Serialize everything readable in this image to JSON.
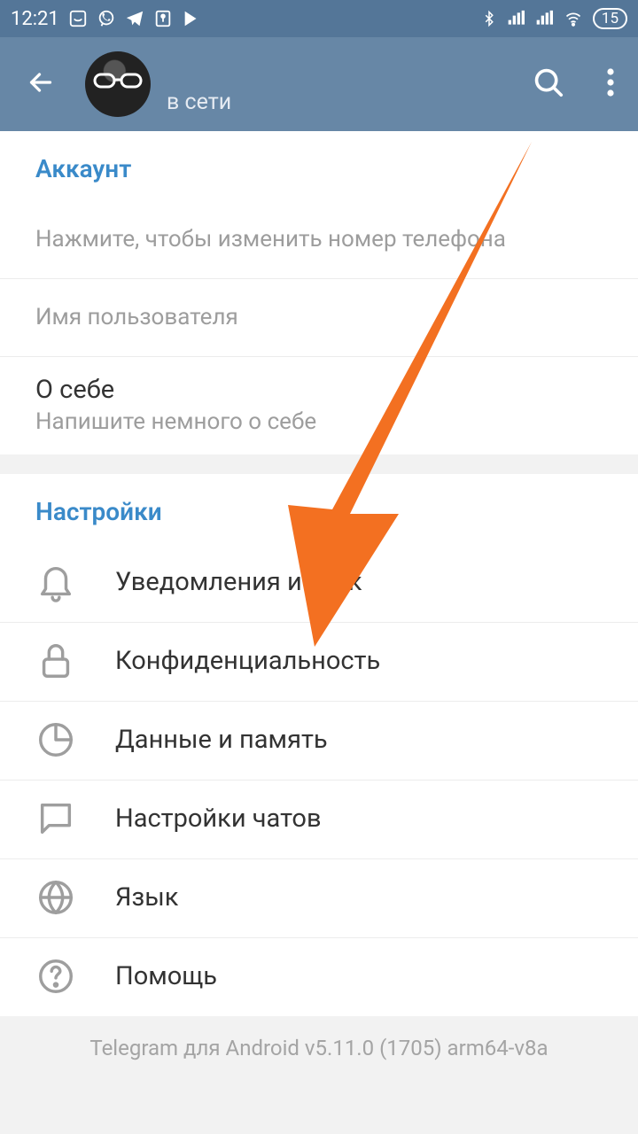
{
  "statusbar": {
    "time": "12:21",
    "battery": "15"
  },
  "header": {
    "status": "в сети"
  },
  "account": {
    "section_title": "Аккаунт",
    "phone_hint": "Нажмите, чтобы изменить номер телефона",
    "username_label": "Имя пользователя",
    "bio_label": "О себе",
    "bio_hint": "Напишите немного о себе"
  },
  "settings": {
    "section_title": "Настройки",
    "items": [
      {
        "label": "Уведомления и звук"
      },
      {
        "label": "Конфиденциальность"
      },
      {
        "label": "Данные и память"
      },
      {
        "label": "Настройки чатов"
      },
      {
        "label": "Язык"
      },
      {
        "label": "Помощь"
      }
    ]
  },
  "version": "Telegram для Android v5.11.0 (1705) arm64-v8a",
  "colors": {
    "accent": "#3a8ac9",
    "header": "#6787a6",
    "arrow": "#f37021"
  }
}
